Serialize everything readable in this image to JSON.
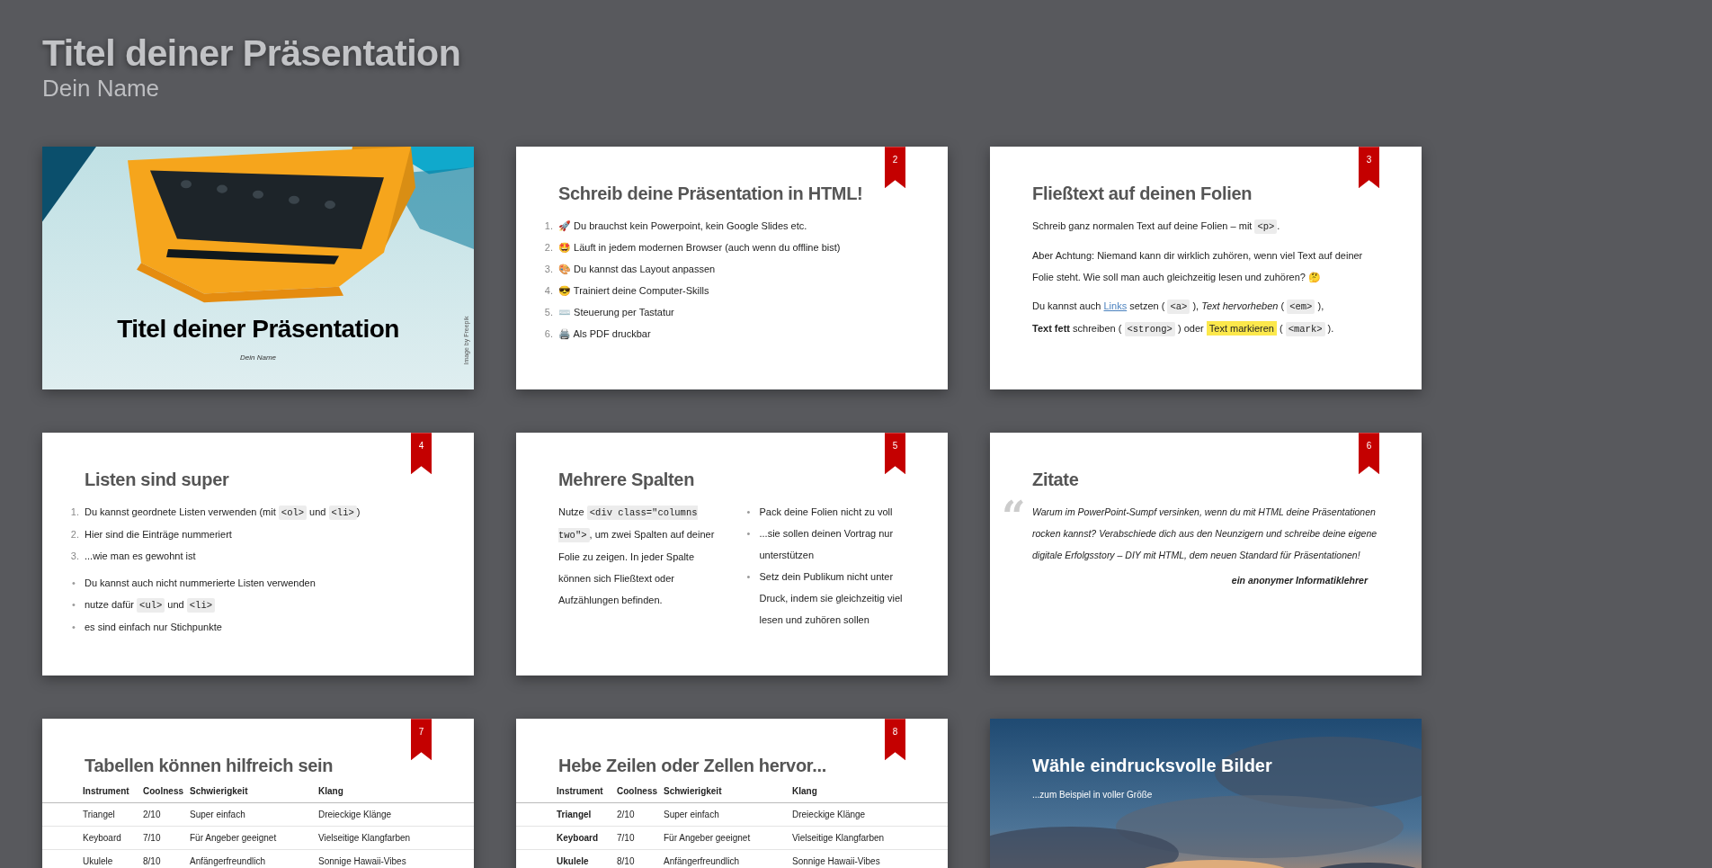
{
  "header": {
    "title": "Titel deiner Präsentation",
    "subtitle": "Dein Name"
  },
  "slides": [
    {
      "kind": "title",
      "title": "Titel deiner Präsentation",
      "subtitle": "Dein Name",
      "credit": "Image by Freepik"
    },
    {
      "kind": "list",
      "number": "2",
      "title": "Schreib deine Präsentation in HTML!",
      "ordered": [
        {
          "marker": "1.",
          "parts": [
            {
              "kind": "text",
              "text": "🚀 Du brauchst kein Powerpoint, kein Google Slides etc."
            }
          ]
        },
        {
          "marker": "2.",
          "parts": [
            {
              "kind": "text",
              "text": "🤩 Läuft in jedem modernen Browser (auch wenn du offline bist)"
            }
          ]
        },
        {
          "marker": "3.",
          "parts": [
            {
              "kind": "text",
              "text": "🎨 Du kannst das Layout anpassen"
            }
          ]
        },
        {
          "marker": "4.",
          "parts": [
            {
              "kind": "text",
              "text": "😎 Trainiert deine Computer-Skills"
            }
          ]
        },
        {
          "marker": "5.",
          "parts": [
            {
              "kind": "text",
              "text": "⌨️ Steuerung per Tastatur"
            }
          ]
        },
        {
          "marker": "6.",
          "parts": [
            {
              "kind": "text",
              "text": "🖨️ Als PDF druckbar"
            }
          ]
        }
      ]
    },
    {
      "kind": "text",
      "number": "3",
      "title": "Fließtext auf deinen Folien",
      "paragraphs": [
        [
          {
            "kind": "text",
            "text": "Schreib ganz normalen Text auf deine Folien – mit "
          },
          {
            "kind": "code",
            "text": "<p>"
          },
          {
            "kind": "text",
            "text": "."
          }
        ],
        [
          {
            "kind": "text",
            "text": "Aber Achtung: Niemand kann dir wirklich zuhören, wenn viel Text auf deiner Folie steht. Wie soll man auch gleichzeitig lesen und zuhören? 🤔"
          }
        ],
        [
          {
            "kind": "text",
            "text": "Du kannst auch "
          },
          {
            "kind": "link",
            "text": "Links"
          },
          {
            "kind": "text",
            "text": " setzen ( "
          },
          {
            "kind": "code",
            "text": "<a>"
          },
          {
            "kind": "text",
            "text": " ), "
          },
          {
            "kind": "em",
            "text": "Text hervorheben"
          },
          {
            "kind": "text",
            "text": " ( "
          },
          {
            "kind": "code",
            "text": "<em>"
          },
          {
            "kind": "text",
            "text": " ),"
          },
          {
            "kind": "break"
          },
          {
            "kind": "strong",
            "text": "Text fett"
          },
          {
            "kind": "text",
            "text": " schreiben ( "
          },
          {
            "kind": "code",
            "text": "<strong>"
          },
          {
            "kind": "text",
            "text": " ) oder "
          },
          {
            "kind": "mark",
            "text": "Text markieren"
          },
          {
            "kind": "text",
            "text": " ( "
          },
          {
            "kind": "code",
            "text": "<mark>"
          },
          {
            "kind": "text",
            "text": " )."
          }
        ]
      ]
    },
    {
      "kind": "list",
      "number": "4",
      "title": "Listen sind super",
      "ordered": [
        {
          "marker": "1.",
          "parts": [
            {
              "kind": "text",
              "text": "Du kannst geordnete Listen verwenden (mit "
            },
            {
              "kind": "code",
              "text": "<ol>"
            },
            {
              "kind": "text",
              "text": " und "
            },
            {
              "kind": "code",
              "text": "<li>"
            },
            {
              "kind": "text",
              "text": ")"
            }
          ]
        },
        {
          "marker": "2.",
          "parts": [
            {
              "kind": "text",
              "text": "Hier sind die Einträge nummeriert"
            }
          ]
        },
        {
          "marker": "3.",
          "parts": [
            {
              "kind": "text",
              "text": "...wie man es gewohnt ist"
            }
          ]
        }
      ],
      "bullets": [
        {
          "marker": "•",
          "parts": [
            {
              "kind": "text",
              "text": "Du kannst auch nicht nummerierte Listen verwenden"
            }
          ]
        },
        {
          "marker": "•",
          "parts": [
            {
              "kind": "text",
              "text": "nutze dafür "
            },
            {
              "kind": "code",
              "text": "<ul>"
            },
            {
              "kind": "text",
              "text": " und "
            },
            {
              "kind": "code",
              "text": "<li>"
            }
          ]
        },
        {
          "marker": "•",
          "parts": [
            {
              "kind": "text",
              "text": "es sind einfach nur Stichpunkte"
            }
          ]
        }
      ]
    },
    {
      "kind": "columns",
      "number": "5",
      "title": "Mehrere Spalten",
      "paragraphs": [
        [
          {
            "kind": "text",
            "text": "Nutze "
          },
          {
            "kind": "code",
            "text": "<div class=\"columns two\">"
          },
          {
            "kind": "text",
            "text": ", um zwei Spalten auf deiner Folie zu zeigen. In jeder Spalte können sich Fließtext oder Aufzählungen befinden."
          }
        ]
      ],
      "bullets": [
        {
          "marker": "•",
          "parts": [
            {
              "kind": "text",
              "text": "Pack deine Folien nicht zu voll"
            }
          ]
        },
        {
          "marker": "•",
          "parts": [
            {
              "kind": "text",
              "text": "...sie sollen deinen Vortrag nur unterstützen"
            }
          ]
        },
        {
          "marker": "•",
          "parts": [
            {
              "kind": "text",
              "text": "Setz dein Publikum nicht unter Druck, indem sie gleichzeitig viel lesen und zuhören sollen"
            }
          ]
        }
      ]
    },
    {
      "kind": "quote",
      "number": "6",
      "title": "Zitate",
      "quote_mark": "“",
      "quote": "Warum im PowerPoint-Sumpf versinken, wenn du mit HTML deine Präsentationen rocken kannst? Verabschiede dich aus den Neunzigern und schreibe deine eigene digitale Erfolgsstory – DIY mit HTML, dem neuen Standard für Präsentationen!",
      "author": "ein anonymer Informatiklehrer"
    },
    {
      "kind": "table",
      "number": "7",
      "title": "Tabellen können hilfreich sein",
      "bold_first_column": false,
      "columns": [
        "Instrument",
        "Coolness",
        "Schwierigkeit",
        "Klang"
      ],
      "rows": [
        [
          "Triangel",
          "2/10",
          "Super einfach",
          "Dreieckige Klänge"
        ],
        [
          "Keyboard",
          "7/10",
          "Für Angeber geeignet",
          "Vielseitige Klangfarben"
        ],
        [
          "Ukulele",
          "8/10",
          "Anfängerfreundlich",
          "Sonnige Hawaii-Vibes"
        ]
      ]
    },
    {
      "kind": "table",
      "number": "8",
      "title": "Hebe Zeilen oder Zellen hervor...",
      "bold_first_column": true,
      "columns": [
        "Instrument",
        "Coolness",
        "Schwierigkeit",
        "Klang"
      ],
      "rows": [
        [
          "Triangel",
          "2/10",
          "Super einfach",
          "Dreieckige Klänge"
        ],
        [
          "Keyboard",
          "7/10",
          "Für Angeber geeignet",
          "Vielseitige Klangfarben"
        ],
        [
          "Ukulele",
          "8/10",
          "Anfängerfreundlich",
          "Sonnige Hawaii-Vibes"
        ]
      ]
    },
    {
      "title": "Wähle eindrucksvolle Bilder",
      "subtitle": "...zum Beispiel in voller Größe"
    }
  ]
}
